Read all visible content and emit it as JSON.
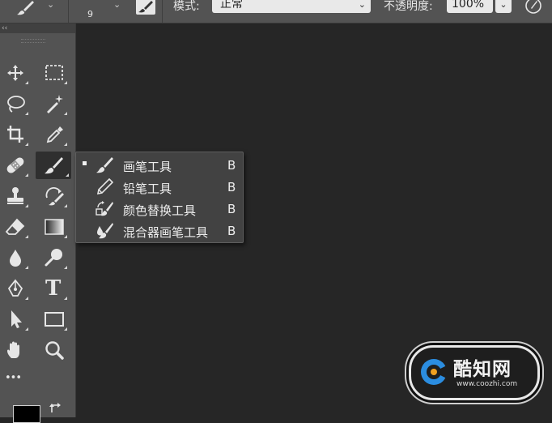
{
  "options_bar": {
    "brush_size": "9",
    "mode_label": "模式:",
    "mode_value": "正常",
    "opacity_label": "不透明度:",
    "opacity_value": "100%"
  },
  "toolbar": {
    "collapse_glyph": "‹‹",
    "tools": [
      {
        "name": "move-tool",
        "icon": "move-icon"
      },
      {
        "name": "marquee-tool",
        "icon": "rect-marquee-icon"
      },
      {
        "name": "lasso-tool",
        "icon": "lasso-icon"
      },
      {
        "name": "magic-wand-tool",
        "icon": "magic-wand-icon"
      },
      {
        "name": "crop-tool",
        "icon": "crop-icon"
      },
      {
        "name": "eyedropper-tool",
        "icon": "eyedropper-icon"
      },
      {
        "name": "healing-brush-tool",
        "icon": "bandage-icon"
      },
      {
        "name": "brush-tool",
        "icon": "brush-icon",
        "active": true
      },
      {
        "name": "stamp-tool",
        "icon": "stamp-icon"
      },
      {
        "name": "history-brush-tool",
        "icon": "history-brush-icon"
      },
      {
        "name": "eraser-tool",
        "icon": "eraser-icon"
      },
      {
        "name": "gradient-tool",
        "icon": "gradient-icon"
      },
      {
        "name": "blur-tool",
        "icon": "drop-icon"
      },
      {
        "name": "dodge-tool",
        "icon": "dodge-icon"
      },
      {
        "name": "pen-tool",
        "icon": "pen-icon"
      },
      {
        "name": "type-tool",
        "icon": "type-icon",
        "glyph": "T"
      },
      {
        "name": "path-selection-tool",
        "icon": "arrow-icon"
      },
      {
        "name": "shape-tool",
        "icon": "rectangle-icon"
      },
      {
        "name": "hand-tool",
        "icon": "hand-icon"
      },
      {
        "name": "zoom-tool",
        "icon": "zoom-icon"
      },
      {
        "name": "more-tools",
        "icon": "ellipsis-icon",
        "glyph": "•••"
      }
    ],
    "foreground_color": "#000000"
  },
  "flyout_menu": {
    "items": [
      {
        "label": "画笔工具",
        "shortcut": "B",
        "selected": true,
        "icon": "brush-icon"
      },
      {
        "label": "铅笔工具",
        "shortcut": "B",
        "selected": false,
        "icon": "pencil-icon"
      },
      {
        "label": "颜色替换工具",
        "shortcut": "B",
        "selected": false,
        "icon": "color-replace-icon"
      },
      {
        "label": "混合器画笔工具",
        "shortcut": "B",
        "selected": false,
        "icon": "mixer-brush-icon"
      }
    ]
  },
  "watermark": {
    "name": "酷知网",
    "url": "www.coozhi.com"
  },
  "colors": {
    "panel": "#535353",
    "canvas": "#262626",
    "menu": "#424242"
  }
}
